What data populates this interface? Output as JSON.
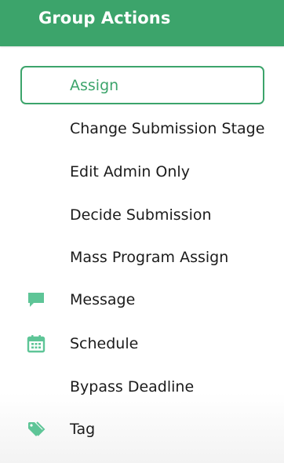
{
  "header": {
    "title": "Group Actions"
  },
  "colors": {
    "accent": "#3ca46b",
    "icon": "#5ec597",
    "text": "#1b1b1b"
  },
  "menu": {
    "items": [
      {
        "label": "Assign",
        "selected": true,
        "icon": ""
      },
      {
        "label": "Change Submission Stage",
        "icon": ""
      },
      {
        "label": "Edit Admin Only",
        "icon": ""
      },
      {
        "label": "Decide Submission",
        "icon": ""
      },
      {
        "label": "Mass Program Assign",
        "icon": ""
      },
      {
        "label": "Message",
        "icon": "message-icon"
      },
      {
        "label": "Schedule",
        "icon": "calendar-icon"
      },
      {
        "label": "Bypass Deadline",
        "icon": ""
      },
      {
        "label": "Tag",
        "icon": "tag-icon"
      }
    ]
  }
}
